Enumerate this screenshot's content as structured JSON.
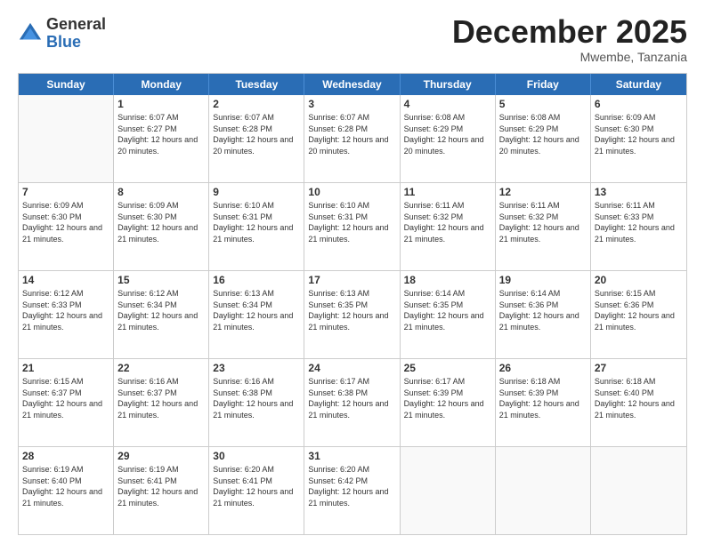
{
  "logo": {
    "general": "General",
    "blue": "Blue"
  },
  "header": {
    "month": "December 2025",
    "location": "Mwembe, Tanzania"
  },
  "days_of_week": [
    "Sunday",
    "Monday",
    "Tuesday",
    "Wednesday",
    "Thursday",
    "Friday",
    "Saturday"
  ],
  "weeks": [
    [
      {
        "day": "",
        "empty": true
      },
      {
        "day": "1",
        "sunrise": "6:07 AM",
        "sunset": "6:27 PM",
        "daylight": "12 hours and 20 minutes."
      },
      {
        "day": "2",
        "sunrise": "6:07 AM",
        "sunset": "6:28 PM",
        "daylight": "12 hours and 20 minutes."
      },
      {
        "day": "3",
        "sunrise": "6:07 AM",
        "sunset": "6:28 PM",
        "daylight": "12 hours and 20 minutes."
      },
      {
        "day": "4",
        "sunrise": "6:08 AM",
        "sunset": "6:29 PM",
        "daylight": "12 hours and 20 minutes."
      },
      {
        "day": "5",
        "sunrise": "6:08 AM",
        "sunset": "6:29 PM",
        "daylight": "12 hours and 20 minutes."
      },
      {
        "day": "6",
        "sunrise": "6:09 AM",
        "sunset": "6:30 PM",
        "daylight": "12 hours and 21 minutes."
      }
    ],
    [
      {
        "day": "7",
        "sunrise": "6:09 AM",
        "sunset": "6:30 PM",
        "daylight": "12 hours and 21 minutes."
      },
      {
        "day": "8",
        "sunrise": "6:09 AM",
        "sunset": "6:30 PM",
        "daylight": "12 hours and 21 minutes."
      },
      {
        "day": "9",
        "sunrise": "6:10 AM",
        "sunset": "6:31 PM",
        "daylight": "12 hours and 21 minutes."
      },
      {
        "day": "10",
        "sunrise": "6:10 AM",
        "sunset": "6:31 PM",
        "daylight": "12 hours and 21 minutes."
      },
      {
        "day": "11",
        "sunrise": "6:11 AM",
        "sunset": "6:32 PM",
        "daylight": "12 hours and 21 minutes."
      },
      {
        "day": "12",
        "sunrise": "6:11 AM",
        "sunset": "6:32 PM",
        "daylight": "12 hours and 21 minutes."
      },
      {
        "day": "13",
        "sunrise": "6:11 AM",
        "sunset": "6:33 PM",
        "daylight": "12 hours and 21 minutes."
      }
    ],
    [
      {
        "day": "14",
        "sunrise": "6:12 AM",
        "sunset": "6:33 PM",
        "daylight": "12 hours and 21 minutes."
      },
      {
        "day": "15",
        "sunrise": "6:12 AM",
        "sunset": "6:34 PM",
        "daylight": "12 hours and 21 minutes."
      },
      {
        "day": "16",
        "sunrise": "6:13 AM",
        "sunset": "6:34 PM",
        "daylight": "12 hours and 21 minutes."
      },
      {
        "day": "17",
        "sunrise": "6:13 AM",
        "sunset": "6:35 PM",
        "daylight": "12 hours and 21 minutes."
      },
      {
        "day": "18",
        "sunrise": "6:14 AM",
        "sunset": "6:35 PM",
        "daylight": "12 hours and 21 minutes."
      },
      {
        "day": "19",
        "sunrise": "6:14 AM",
        "sunset": "6:36 PM",
        "daylight": "12 hours and 21 minutes."
      },
      {
        "day": "20",
        "sunrise": "6:15 AM",
        "sunset": "6:36 PM",
        "daylight": "12 hours and 21 minutes."
      }
    ],
    [
      {
        "day": "21",
        "sunrise": "6:15 AM",
        "sunset": "6:37 PM",
        "daylight": "12 hours and 21 minutes."
      },
      {
        "day": "22",
        "sunrise": "6:16 AM",
        "sunset": "6:37 PM",
        "daylight": "12 hours and 21 minutes."
      },
      {
        "day": "23",
        "sunrise": "6:16 AM",
        "sunset": "6:38 PM",
        "daylight": "12 hours and 21 minutes."
      },
      {
        "day": "24",
        "sunrise": "6:17 AM",
        "sunset": "6:38 PM",
        "daylight": "12 hours and 21 minutes."
      },
      {
        "day": "25",
        "sunrise": "6:17 AM",
        "sunset": "6:39 PM",
        "daylight": "12 hours and 21 minutes."
      },
      {
        "day": "26",
        "sunrise": "6:18 AM",
        "sunset": "6:39 PM",
        "daylight": "12 hours and 21 minutes."
      },
      {
        "day": "27",
        "sunrise": "6:18 AM",
        "sunset": "6:40 PM",
        "daylight": "12 hours and 21 minutes."
      }
    ],
    [
      {
        "day": "28",
        "sunrise": "6:19 AM",
        "sunset": "6:40 PM",
        "daylight": "12 hours and 21 minutes."
      },
      {
        "day": "29",
        "sunrise": "6:19 AM",
        "sunset": "6:41 PM",
        "daylight": "12 hours and 21 minutes."
      },
      {
        "day": "30",
        "sunrise": "6:20 AM",
        "sunset": "6:41 PM",
        "daylight": "12 hours and 21 minutes."
      },
      {
        "day": "31",
        "sunrise": "6:20 AM",
        "sunset": "6:42 PM",
        "daylight": "12 hours and 21 minutes."
      },
      {
        "day": "",
        "empty": true
      },
      {
        "day": "",
        "empty": true
      },
      {
        "day": "",
        "empty": true
      }
    ]
  ]
}
